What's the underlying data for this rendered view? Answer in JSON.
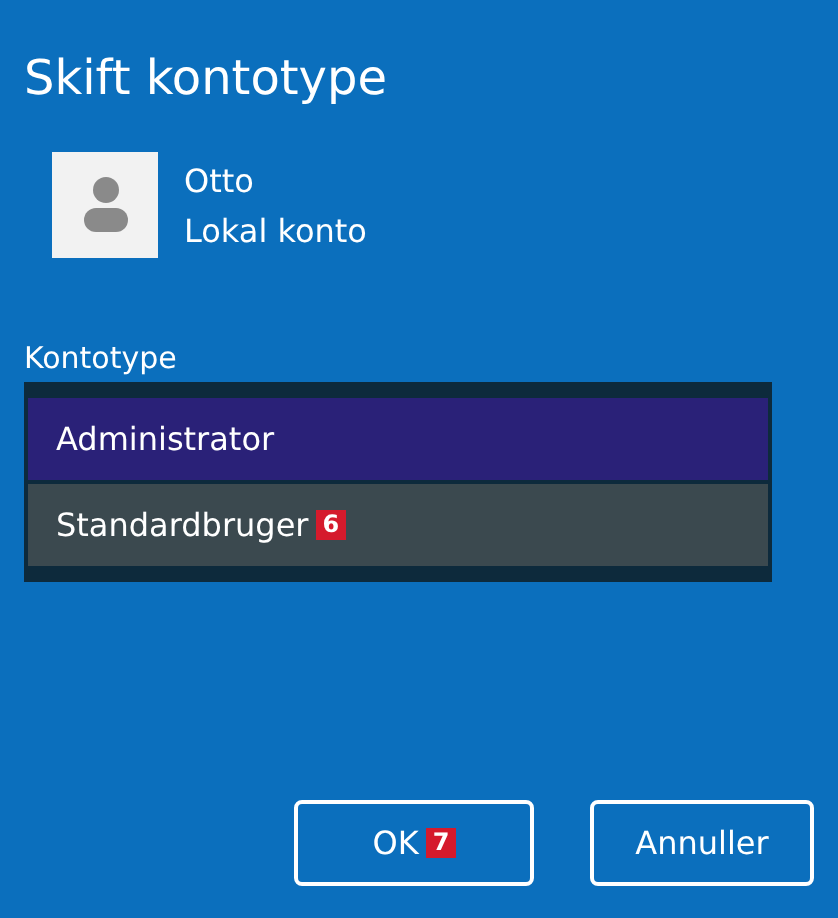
{
  "window": {
    "title": "Skift kontotype"
  },
  "account": {
    "name": "Otto",
    "type": "Lokal konto"
  },
  "account_type": {
    "label": "Kontotype",
    "options": [
      {
        "label": "Administrator",
        "selected": true,
        "hovered": false
      },
      {
        "label": "Standardbruger",
        "selected": false,
        "hovered": true,
        "badge": "6"
      }
    ]
  },
  "buttons": [
    {
      "label": "OK",
      "badge": "7"
    },
    {
      "label": "Annuller"
    }
  ]
}
